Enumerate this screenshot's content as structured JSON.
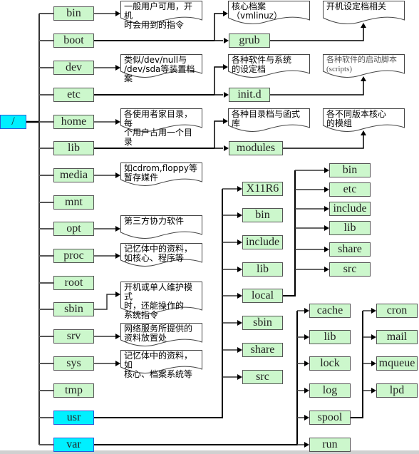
{
  "colors": {
    "folder_fill": "#ccf7cc",
    "highlight_fill": "#00f0ff",
    "line": "#000000"
  },
  "root": "/",
  "level1": [
    "bin",
    "boot",
    "dev",
    "etc",
    "home",
    "lib",
    "media",
    "mnt",
    "opt",
    "proc",
    "root",
    "sbin",
    "srv",
    "sys",
    "tmp",
    "usr",
    "var"
  ],
  "notes": {
    "bin": "一般用户可用，开机\n时会用到的指令",
    "dev": "类似/dev/null与\n/dev/sda等装置档案",
    "home": "各使用者家目录，每\n个用户占用一个目录",
    "media": "如cdrom,floppy等\n暂存媒件",
    "opt": "第三方协力软件",
    "proc": "记忆体中的资料，\n如核心、程序等",
    "sbin": "开机或单人维护模式\n时，还能操作的\n系统指令",
    "srv": "网络服务所提供的\n资料放置处",
    "sys": "记忆体中的资料，如\n核心、档案系统等"
  },
  "boot": {
    "kernel_note": "核心档案（vmlinuz）",
    "grub": "grub",
    "grub_note": "开机设定档相关"
  },
  "etc": {
    "config_note": "各种软件与系统\n的设定档",
    "initd": "init.d",
    "initd_note": "各种软件的启动脚本\n(scripts)"
  },
  "lib": {
    "lib_note": "各种目录档与函式库",
    "modules": "modules",
    "modules_note": "各不同版本核心\n的模组"
  },
  "usr": {
    "children": [
      "X11R6",
      "bin",
      "include",
      "lib",
      "local",
      "sbin",
      "share",
      "src"
    ],
    "local_children": [
      "bin",
      "etc",
      "include",
      "lib",
      "share",
      "src"
    ]
  },
  "var": {
    "children": [
      "cache",
      "lib",
      "lock",
      "log",
      "spool",
      "run"
    ],
    "spool_children": [
      "cron",
      "mail",
      "mqueue",
      "lpd"
    ]
  }
}
